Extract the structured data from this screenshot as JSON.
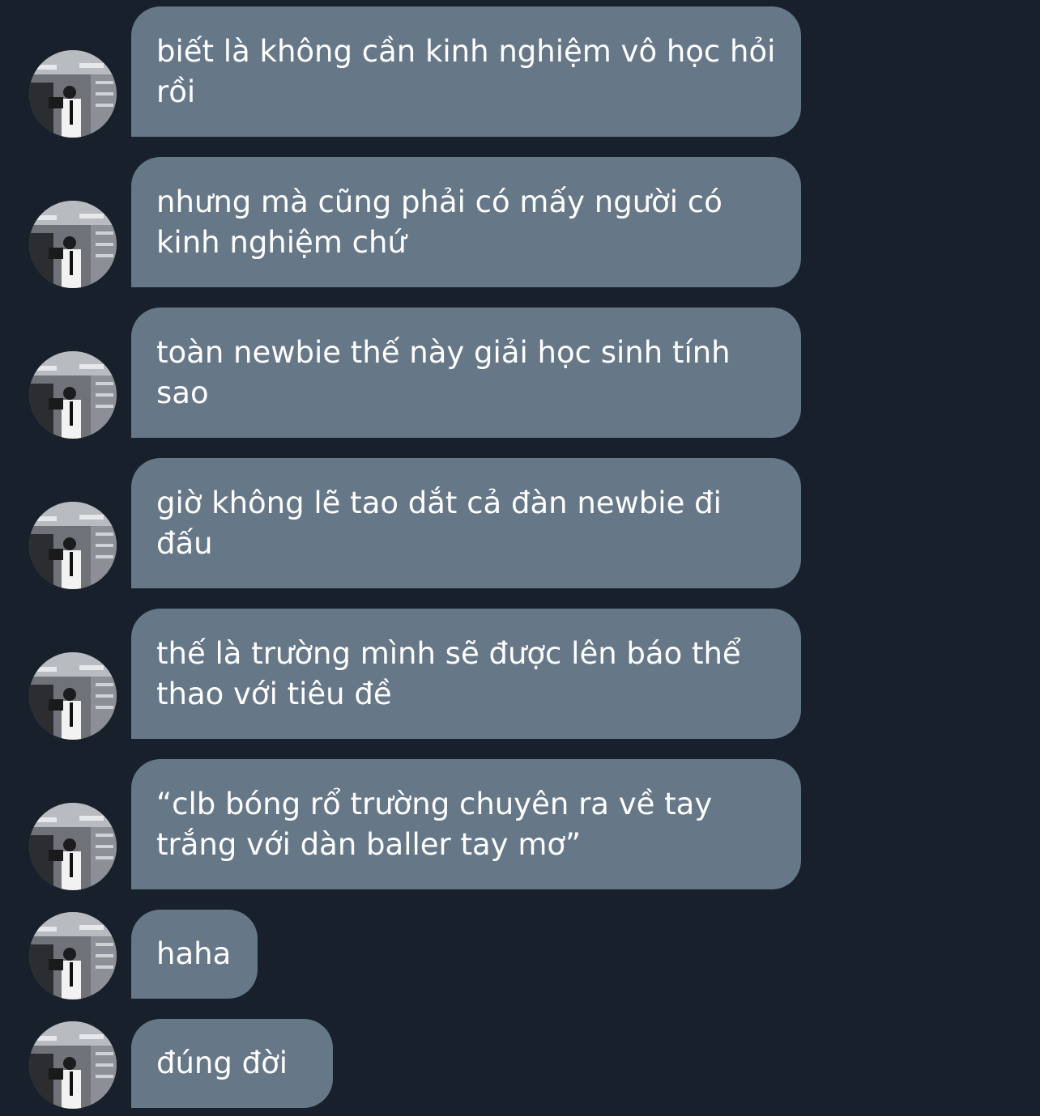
{
  "conversation": {
    "messages": [
      {
        "text": "biết là không cần kinh nghiệm vô học hỏi rồi"
      },
      {
        "text": "nhưng mà cũng phải có mấy người có kinh nghiệm chứ"
      },
      {
        "text": "toàn newbie thế này giải học sinh tính sao"
      },
      {
        "text": "giờ không lẽ tao dắt cả đàn newbie đi đấu"
      },
      {
        "text": "thế là trường mình sẽ được lên báo thể thao với tiêu đề"
      },
      {
        "text": "“clb bóng rổ trường chuyên ra về tay trắng với dàn baller tay mơ”"
      },
      {
        "text": "haha"
      },
      {
        "text": "đúng đời"
      }
    ]
  },
  "colors": {
    "background": "#18202b",
    "bubble": "#667788",
    "text": "#ffffff"
  }
}
